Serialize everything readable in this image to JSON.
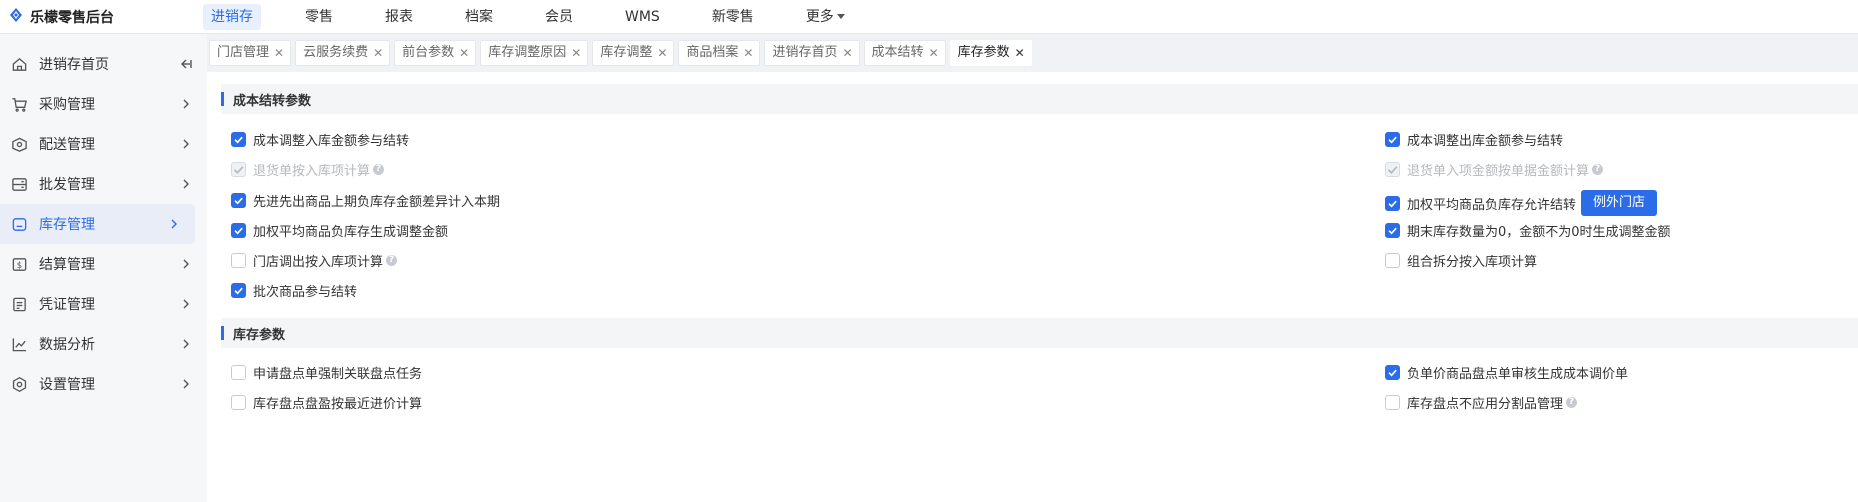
{
  "brand": {
    "name": "乐檬零售后台"
  },
  "topnav": {
    "items": [
      "进销存",
      "零售",
      "报表",
      "档案",
      "会员",
      "WMS",
      "新零售",
      "更多"
    ]
  },
  "sidebar": {
    "items": [
      {
        "label": "进销存首页",
        "icon": "home-icon"
      },
      {
        "label": "采购管理",
        "icon": "cart-icon"
      },
      {
        "label": "配送管理",
        "icon": "box-icon"
      },
      {
        "label": "批发管理",
        "icon": "server-icon"
      },
      {
        "label": "库存管理",
        "icon": "inventory-icon"
      },
      {
        "label": "结算管理",
        "icon": "dollar-icon"
      },
      {
        "label": "凭证管理",
        "icon": "document-icon"
      },
      {
        "label": "数据分析",
        "icon": "chart-icon"
      },
      {
        "label": "设置管理",
        "icon": "gear-icon"
      }
    ]
  },
  "tabs": [
    "门店管理",
    "云服务续费",
    "前台参数",
    "库存调整原因",
    "库存调整",
    "商品档案",
    "进销存首页",
    "成本结转",
    "库存参数"
  ],
  "sections": {
    "cost": {
      "title": "成本结转参数",
      "left": [
        "成本调整入库金额参与结转",
        "退货单按入库项计算",
        "先进先出商品上期负库存金额差异计入本期",
        "加权平均商品负库存生成调整金额",
        "门店调出按入库项计算",
        "批次商品参与结转"
      ],
      "right": [
        "成本调整出库金额参与结转",
        "退货单入项金额按单据金额计算",
        "加权平均商品负库存允许结转",
        "期末库存数量为0，金额不为0时生成调整金额",
        "组合拆分按入库项计算"
      ],
      "exception_button": "例外门店"
    },
    "stock": {
      "title": "库存参数",
      "left": [
        "申请盘点单强制关联盘点任务",
        "库存盘点盘盈按最近进价计算"
      ],
      "right": [
        "负单价商品盘点单审核生成成本调价单",
        "库存盘点不应用分割品管理"
      ]
    }
  },
  "colors": {
    "accent": "#2b6de8",
    "sidebar_bg": "#f6f7f9",
    "tabbar_bg": "#f0f2f5"
  }
}
